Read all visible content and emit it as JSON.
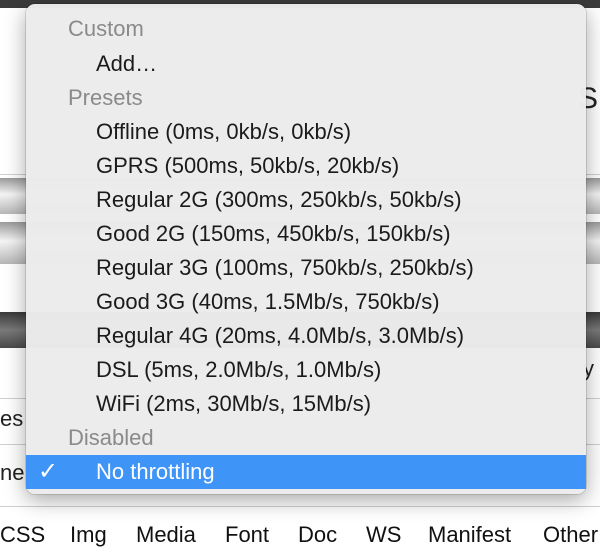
{
  "background": {
    "fragments": {
      "s": "S",
      "y": "y",
      "es": "es",
      "ne": "ne"
    },
    "filters": [
      "CSS",
      "Img",
      "Media",
      "Font",
      "Doc",
      "WS",
      "Manifest",
      "Other"
    ]
  },
  "menu": {
    "custom_header": "Custom",
    "add_label": "Add…",
    "presets_header": "Presets",
    "presets": [
      "Offline (0ms, 0kb/s, 0kb/s)",
      "GPRS (500ms, 50kb/s, 20kb/s)",
      "Regular 2G (300ms, 250kb/s, 50kb/s)",
      "Good 2G (150ms, 450kb/s, 150kb/s)",
      "Regular 3G (100ms, 750kb/s, 250kb/s)",
      "Good 3G (40ms, 1.5Mb/s, 750kb/s)",
      "Regular 4G (20ms, 4.0Mb/s, 3.0Mb/s)",
      "DSL (5ms, 2.0Mb/s, 1.0Mb/s)",
      "WiFi (2ms, 30Mb/s, 15Mb/s)"
    ],
    "disabled_header": "Disabled",
    "no_throttling_label": "No throttling",
    "check_glyph": "✓"
  },
  "colors": {
    "selection": "#3f94f7",
    "header_text": "#8a8a8a"
  }
}
